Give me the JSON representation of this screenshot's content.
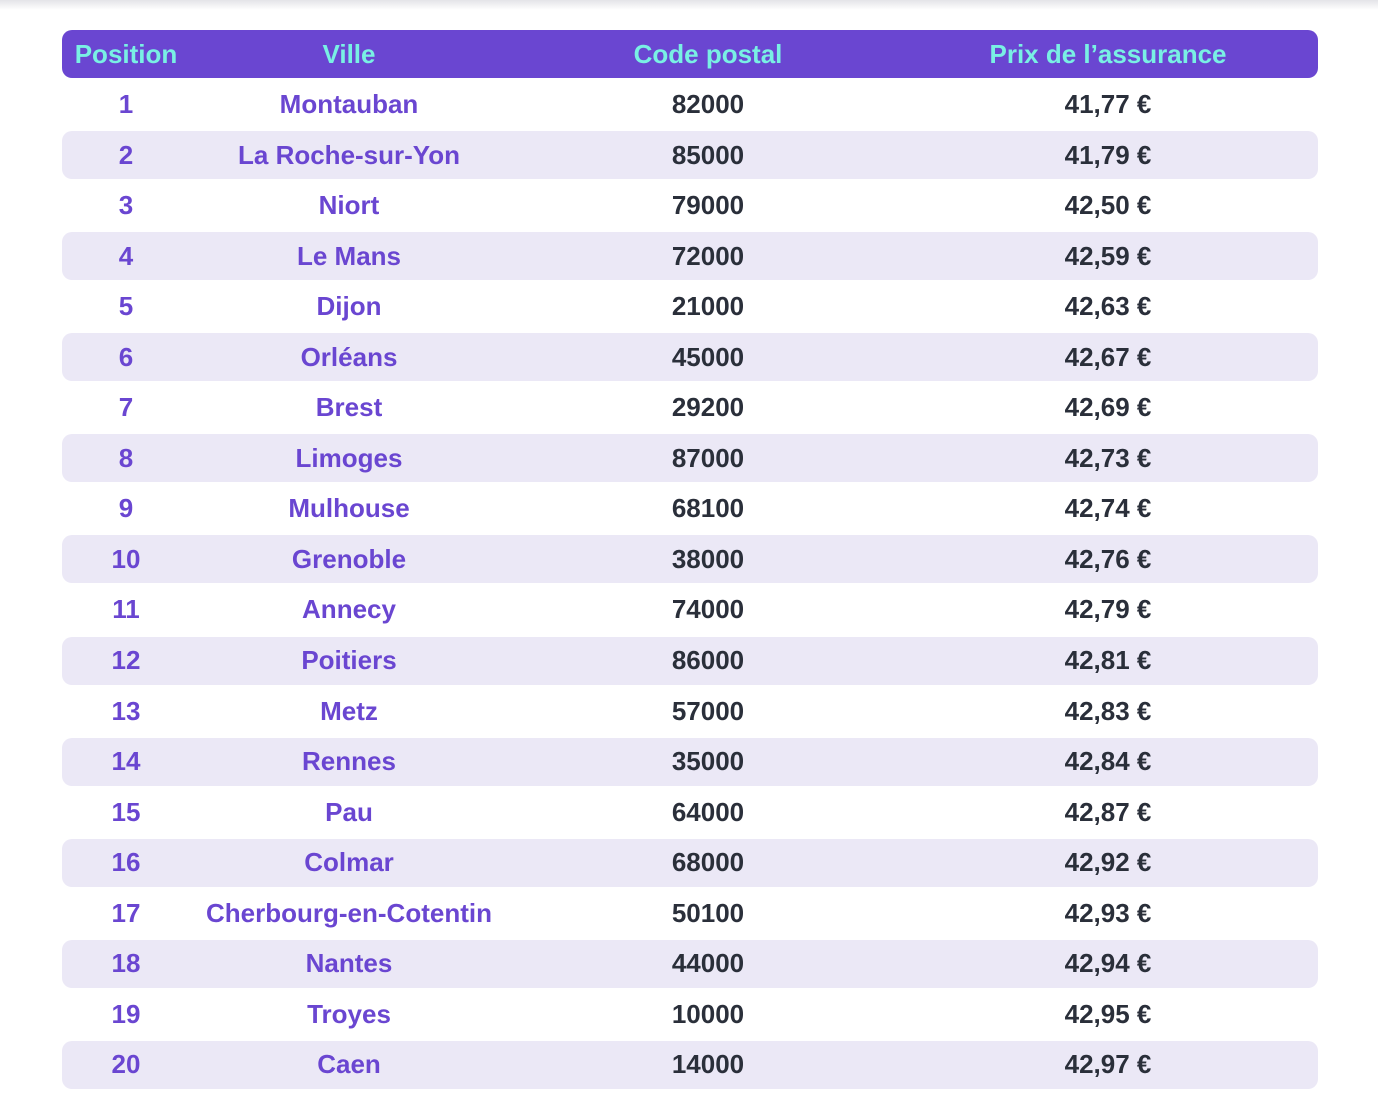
{
  "header": {
    "position": "Position",
    "city": "Ville",
    "zip": "Code postal",
    "price": "Prix de l’assurance"
  },
  "rows": [
    {
      "position": "1",
      "city": "Montauban",
      "zip": "82000",
      "price": "41,77 €"
    },
    {
      "position": "2",
      "city": "La Roche-sur-Yon",
      "zip": "85000",
      "price": "41,79 €"
    },
    {
      "position": "3",
      "city": "Niort",
      "zip": "79000",
      "price": "42,50 €"
    },
    {
      "position": "4",
      "city": "Le Mans",
      "zip": "72000",
      "price": "42,59 €"
    },
    {
      "position": "5",
      "city": "Dijon",
      "zip": "21000",
      "price": "42,63 €"
    },
    {
      "position": "6",
      "city": "Orléans",
      "zip": "45000",
      "price": "42,67 €"
    },
    {
      "position": "7",
      "city": "Brest",
      "zip": "29200",
      "price": "42,69 €"
    },
    {
      "position": "8",
      "city": "Limoges",
      "zip": "87000",
      "price": "42,73 €"
    },
    {
      "position": "9",
      "city": "Mulhouse",
      "zip": "68100",
      "price": "42,74 €"
    },
    {
      "position": "10",
      "city": "Grenoble",
      "zip": "38000",
      "price": "42,76 €"
    },
    {
      "position": "11",
      "city": "Annecy",
      "zip": "74000",
      "price": "42,79 €"
    },
    {
      "position": "12",
      "city": "Poitiers",
      "zip": "86000",
      "price": "42,81 €"
    },
    {
      "position": "13",
      "city": "Metz",
      "zip": "57000",
      "price": "42,83 €"
    },
    {
      "position": "14",
      "city": "Rennes",
      "zip": "35000",
      "price": "42,84 €"
    },
    {
      "position": "15",
      "city": "Pau",
      "zip": "64000",
      "price": "42,87 €"
    },
    {
      "position": "16",
      "city": "Colmar",
      "zip": "68000",
      "price": "42,92 €"
    },
    {
      "position": "17",
      "city": "Cherbourg-en-Cotentin",
      "zip": "50100",
      "price": "42,93 €"
    },
    {
      "position": "18",
      "city": "Nantes",
      "zip": "44000",
      "price": "42,94 €"
    },
    {
      "position": "19",
      "city": "Troyes",
      "zip": "10000",
      "price": "42,95 €"
    },
    {
      "position": "20",
      "city": "Caen",
      "zip": "14000",
      "price": "42,97 €"
    }
  ],
  "colors": {
    "header_bg": "#6a46d1",
    "header_text": "#79f0e4",
    "accent_text": "#6a46d1",
    "dark_text": "#2a2f3a",
    "stripe_bg": "#ebe8f6"
  }
}
